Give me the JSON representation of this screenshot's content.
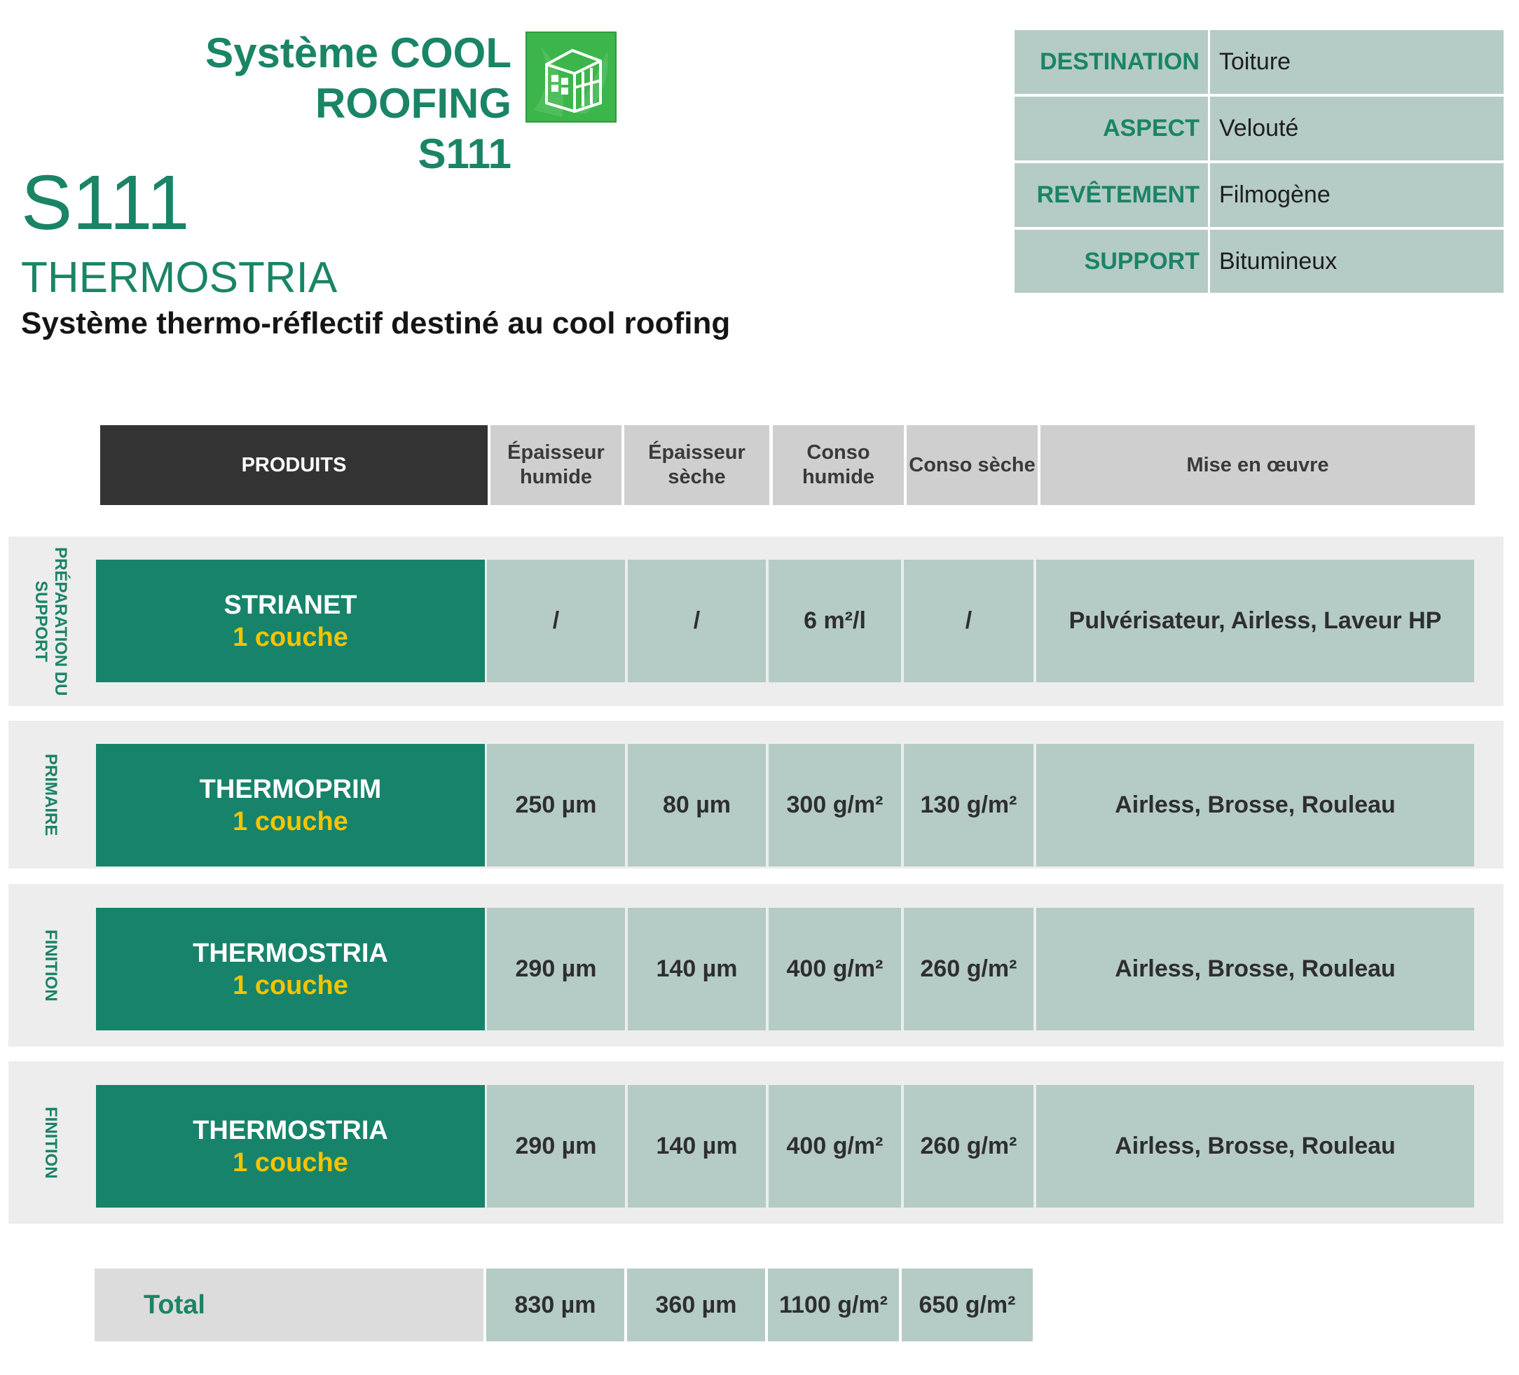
{
  "header": {
    "system_line1": "Système COOL ROOFING",
    "system_line2": "S111",
    "code": "S111",
    "product": "THERMOSTRIA",
    "subtitle": "Système thermo-réflectif destiné au cool roofing"
  },
  "logo": {
    "icon": "greenhouse-icon",
    "color": "#3cb54a"
  },
  "info": [
    {
      "label": "DESTINATION",
      "value": "Toiture"
    },
    {
      "label": "ASPECT",
      "value": "Velouté"
    },
    {
      "label": "REVÊTEMENT",
      "value": "Filmogène"
    },
    {
      "label": "SUPPORT",
      "value": "Bitumineux"
    }
  ],
  "columns": [
    "PRODUITS",
    "Épaisseur humide",
    "Épaisseur sèche",
    "Conso humide",
    "Conso sèche",
    "Mise en œuvre"
  ],
  "sections": [
    {
      "label": "PRÉPARATION DU SUPPORT",
      "product": "STRIANET",
      "coats": "1 couche",
      "wet_thickness": "/",
      "dry_thickness": "/",
      "wet_consumption": "6 m²/l",
      "dry_consumption": "/",
      "application": "Pulvérisateur, Airless, Laveur HP"
    },
    {
      "label": "PRIMAIRE",
      "product": "THERMOPRIM",
      "coats": "1 couche",
      "wet_thickness": "250 µm",
      "dry_thickness": "80 µm",
      "wet_consumption": "300 g/m²",
      "dry_consumption": "130 g/m²",
      "application": "Airless, Brosse, Rouleau"
    },
    {
      "label": "FINITION",
      "product": "THERMOSTRIA",
      "coats": "1 couche",
      "wet_thickness": "290 µm",
      "dry_thickness": "140 µm",
      "wet_consumption": "400 g/m²",
      "dry_consumption": "260 g/m²",
      "application": "Airless, Brosse, Rouleau"
    },
    {
      "label": "FINITION",
      "product": "THERMOSTRIA",
      "coats": "1 couche",
      "wet_thickness": "290 µm",
      "dry_thickness": "140 µm",
      "wet_consumption": "400 g/m²",
      "dry_consumption": "260 g/m²",
      "application": "Airless, Brosse, Rouleau"
    }
  ],
  "total": {
    "label": "Total",
    "wet_thickness": "830 µm",
    "dry_thickness": "360 µm",
    "wet_consumption": "1100 g/m²",
    "dry_consumption": "650 g/m²"
  },
  "colors": {
    "brand_green": "#1a8466",
    "product_cell": "#17836a",
    "coats_yellow": "#f5c400",
    "value_cell": "#b5cbc6",
    "header_dark": "#333333",
    "header_grey": "#cfcfcf",
    "band_grey": "#ededed"
  }
}
